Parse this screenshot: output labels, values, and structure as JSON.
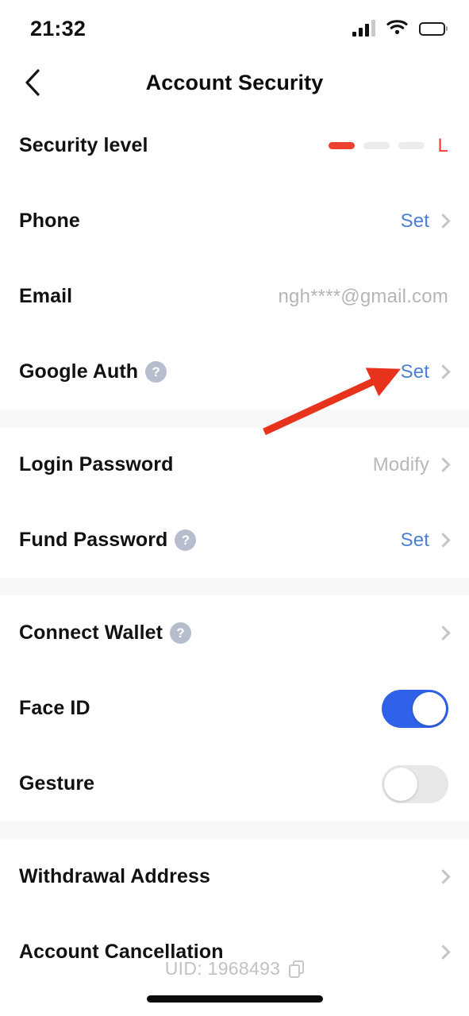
{
  "status_bar": {
    "time": "21:32",
    "signal_icon": "cellular-signal-icon",
    "wifi_icon": "wifi-icon",
    "battery_icon": "battery-low-icon"
  },
  "nav": {
    "back_icon": "chevron-left-icon",
    "title": "Account Security"
  },
  "sections": [
    {
      "rows": [
        {
          "label": "Security level",
          "type": "meter",
          "meter": {
            "segments": 3,
            "filled": 1,
            "level_label": "L",
            "color": "#ef4130"
          }
        },
        {
          "label": "Phone",
          "type": "link",
          "action": "Set",
          "action_style": "blue",
          "chevron": true
        },
        {
          "label": "Email",
          "type": "value",
          "value": "ngh****@gmail.com",
          "chevron": false
        },
        {
          "label": "Google Auth",
          "type": "link",
          "help": true,
          "action": "Set",
          "action_style": "blue",
          "chevron": true
        }
      ]
    },
    {
      "rows": [
        {
          "label": "Login Password",
          "type": "link",
          "action": "Modify",
          "action_style": "muted",
          "chevron": true
        },
        {
          "label": "Fund Password",
          "type": "link",
          "help": true,
          "action": "Set",
          "action_style": "blue",
          "chevron": true
        }
      ]
    },
    {
      "rows": [
        {
          "label": "Connect Wallet",
          "type": "chevron-only",
          "help": true,
          "chevron": true
        },
        {
          "label": "Face ID",
          "type": "toggle",
          "toggle_on": true
        },
        {
          "label": "Gesture",
          "type": "toggle",
          "toggle_on": false
        }
      ]
    },
    {
      "rows": [
        {
          "label": "Withdrawal Address",
          "type": "chevron-only",
          "chevron": true
        },
        {
          "label": "Account Cancellation",
          "type": "chevron-only",
          "chevron": true
        }
      ]
    }
  ],
  "footer": {
    "uid_text": "UID: 1968493",
    "copy_icon": "copy-icon"
  },
  "annotation": {
    "arrow_icon": "red-arrow-annotation",
    "color": "#e8331c",
    "points_to": "Set"
  }
}
